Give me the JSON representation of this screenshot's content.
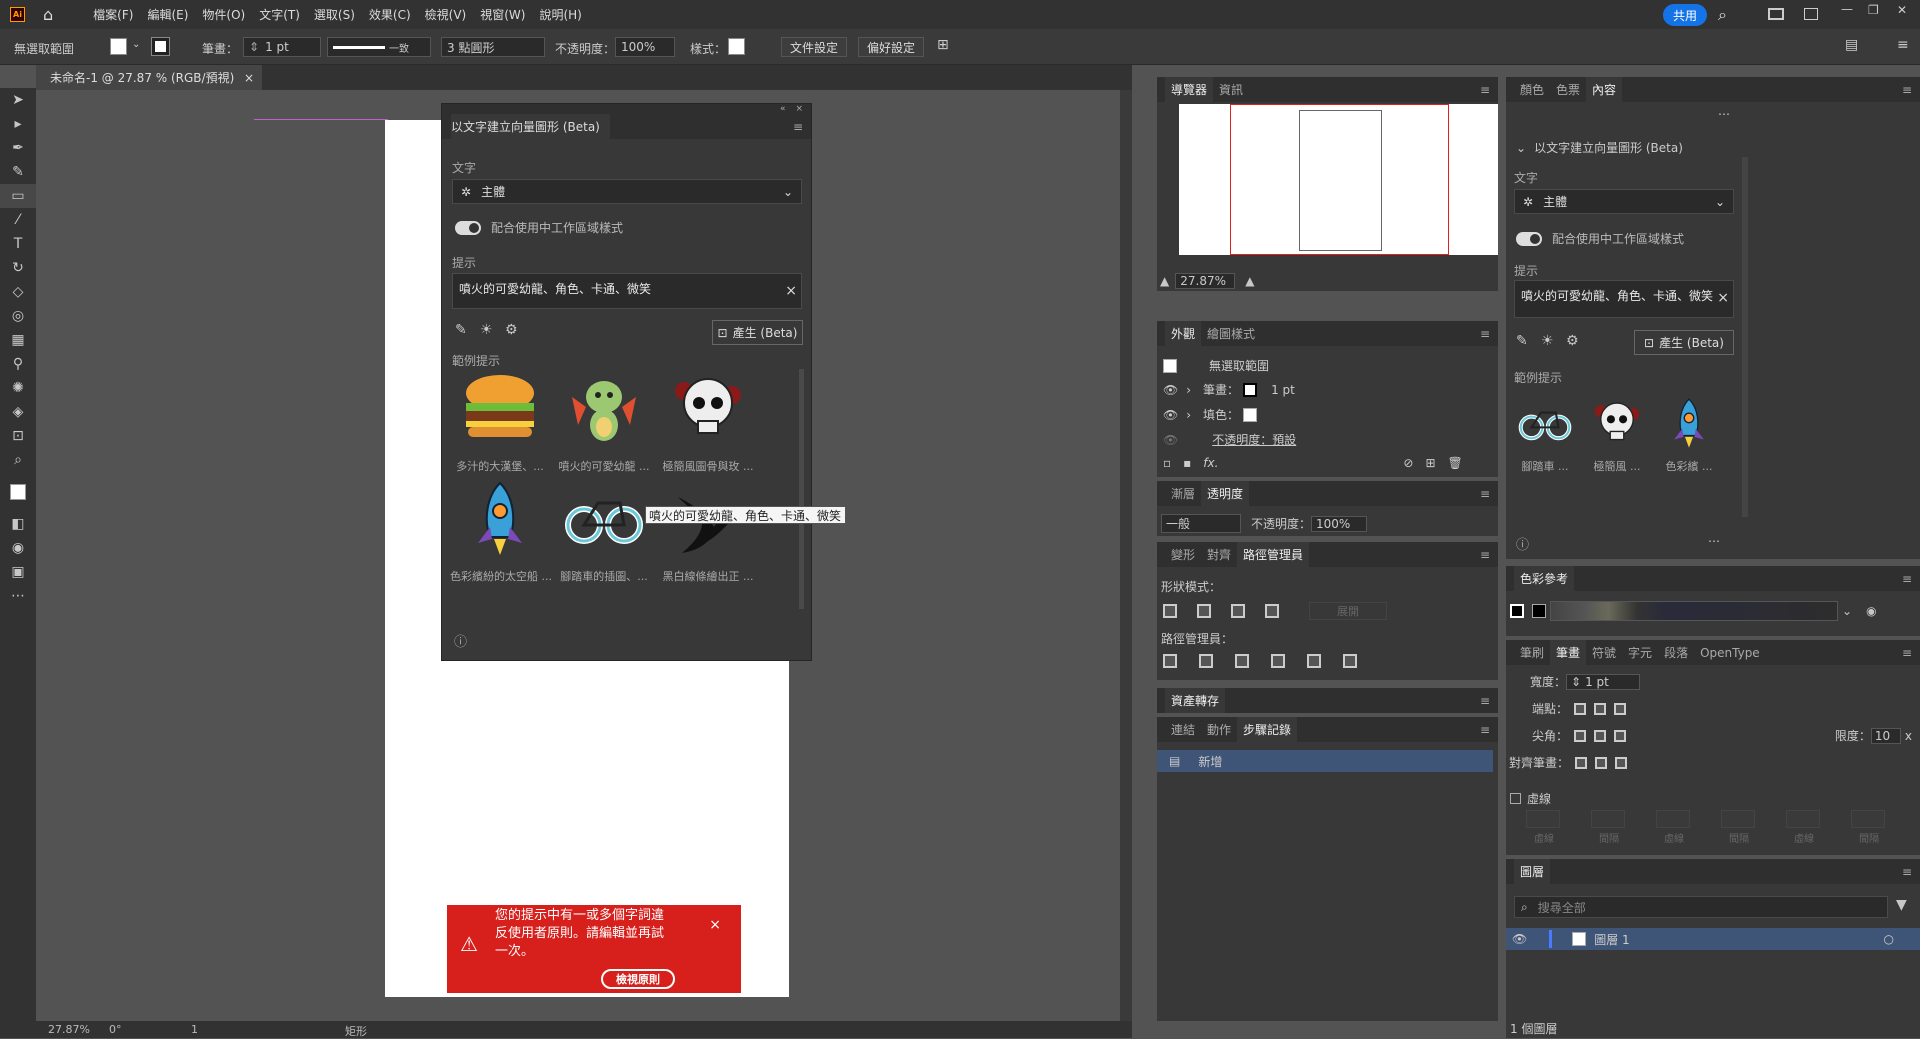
{
  "app": {
    "logo": "Ai",
    "share_label": "共用"
  },
  "menu": [
    "檔案(F)",
    "編輯(E)",
    "物件(O)",
    "文字(T)",
    "選取(S)",
    "效果(C)",
    "檢視(V)",
    "視窗(W)",
    "說明(H)"
  ],
  "control": {
    "selection": "無選取範圍",
    "stroke_label": "筆畫：",
    "stroke_value": "1 pt",
    "stroke_style": "一致",
    "brush": "3 點圓形",
    "opacity_label": "不透明度：",
    "opacity_value": "100%",
    "style_label": "樣式：",
    "doc_setup": "文件設定",
    "prefs": "偏好設定"
  },
  "document": {
    "tab": "未命名-1 @ 27.87 % (RGB/預視)",
    "close": "×"
  },
  "status": {
    "zoom": "27.87%",
    "rotate": "0°",
    "artboard": "1",
    "tool": "矩形"
  },
  "gen_panel": {
    "title": "以文字建立向量圖形 (Beta)",
    "text_label": "文字",
    "subject": "主體",
    "toggle_label": "配合使用中工作區域樣式",
    "prompt_label": "提示",
    "prompt": "噴火的可愛幼龍、角色、卡通、微笑",
    "generate": "產生 (Beta)",
    "samples_label": "範例提示",
    "samples": [
      {
        "name": "hamburger",
        "caption": "多汁的大漢堡、..."
      },
      {
        "name": "dragon",
        "caption": "噴火的可愛幼龍 ..."
      },
      {
        "name": "skull",
        "caption": "極簡風圖骨與玫 ..."
      },
      {
        "name": "rocket",
        "caption": "色彩繽紛的太空船 ..."
      },
      {
        "name": "bicycle",
        "caption": "腳踏車的插圖、..."
      },
      {
        "name": "bird",
        "caption": "黑白線條繪出正 ..."
      }
    ]
  },
  "tooltip": "噴火的可愛幼龍、角色、卡通、微笑",
  "error": {
    "message": "您的提示中有一或多個字詞違反使用者原則。請編輯並再試一次。",
    "button": "檢視原則",
    "close": "×"
  },
  "navigator": {
    "tabs": [
      "導覽器",
      "資訊"
    ],
    "zoom": "27.87%"
  },
  "appearance": {
    "tabs": [
      "外觀",
      "繪圖樣式"
    ],
    "selection": "無選取範圍",
    "stroke": "筆畫：",
    "stroke_value": "1 pt",
    "fill": "填色：",
    "opacity": "不透明度：預設",
    "fx": "fx."
  },
  "transparency": {
    "tabs": [
      "漸層",
      "透明度"
    ],
    "mode": "一般",
    "opacity_label": "不透明度：",
    "opacity_value": "100%"
  },
  "pathfinder": {
    "tabs": [
      "變形",
      "對齊",
      "路徑管理員"
    ],
    "shape_modes": "形狀模式：",
    "expand": "展開",
    "pathfinders": "路徑管理員："
  },
  "asset_export": {
    "title": "資產轉存"
  },
  "history": {
    "tabs": [
      "連結",
      "動作",
      "步驟記錄"
    ],
    "item": "新增"
  },
  "properties": {
    "tabs": [
      "顏色",
      "色票",
      "內容"
    ],
    "gen_title": "以文字建立向量圖形 (Beta)",
    "text_label": "文字",
    "subject": "主體",
    "toggle_label": "配合使用中工作區域樣式",
    "prompt_label": "提示",
    "prompt": "噴火的可愛幼龍、角色、卡通、微笑",
    "generate": "產生 (Beta)",
    "samples_label": "範例提示",
    "samples": [
      {
        "name": "bicycle",
        "caption": "腳踏車 ..."
      },
      {
        "name": "skull",
        "caption": "極簡風 ..."
      },
      {
        "name": "rocket",
        "caption": "色彩繽 ..."
      }
    ]
  },
  "color_guide": {
    "title": "色彩參考"
  },
  "stroke_panel": {
    "tabs": [
      "筆刷",
      "筆畫",
      "符號",
      "字元",
      "段落",
      "OpenType"
    ],
    "width_label": "寬度：",
    "width": "1 pt",
    "cap": "端點：",
    "corner": "尖角：",
    "limit_label": "限度：",
    "limit": "10",
    "align": "對齊筆畫：",
    "dashed": "虛線",
    "dash_labels": [
      "虛線",
      "間隔",
      "虛線",
      "間隔",
      "虛線",
      "間隔"
    ]
  },
  "layers": {
    "title": "圖層",
    "search": "搜尋全部",
    "layer": "圖層 1",
    "count": "1 個圖層"
  }
}
